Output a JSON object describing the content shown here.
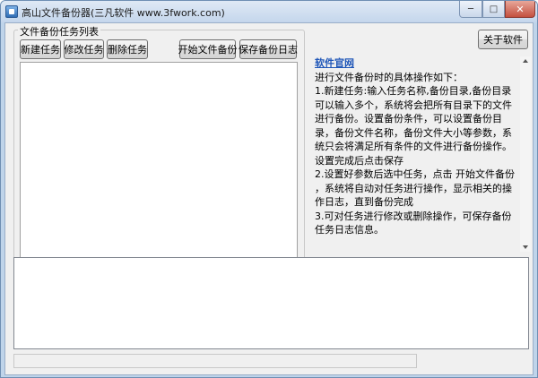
{
  "window": {
    "title": "高山文件备份器(三凡软件 www.3fwork.com)",
    "minimize_glyph": "─",
    "maximize_glyph": "□",
    "close_glyph": "✕"
  },
  "task_group": {
    "legend": "文件备份任务列表",
    "buttons": {
      "new": "新建任务",
      "edit": "修改任务",
      "delete": "删除任务",
      "start": "开始文件备份",
      "save_log": "保存备份日志"
    }
  },
  "about_button": "关于软件",
  "info": {
    "link": "软件官网",
    "text": "进行文件备份时的具体操作如下：\n1.新建任务:输入任务名称,备份目录,备份目录可以输入多个，系统将会把所有目录下的文件进行备份。设置备份条件，可以设置备份目录，备份文件名称，备份文件大小等参数，系统只会将满足所有条件的文件进行备份操作。设置完成后点击保存\n2.设置好参数后选中任务，点击 开始文件备份 ，系统将自动对任务进行操作，显示相关的操作日志，直到备份完成\n3.可对任务进行修改或删除操作，可保存备份任务日志信息。"
  }
}
